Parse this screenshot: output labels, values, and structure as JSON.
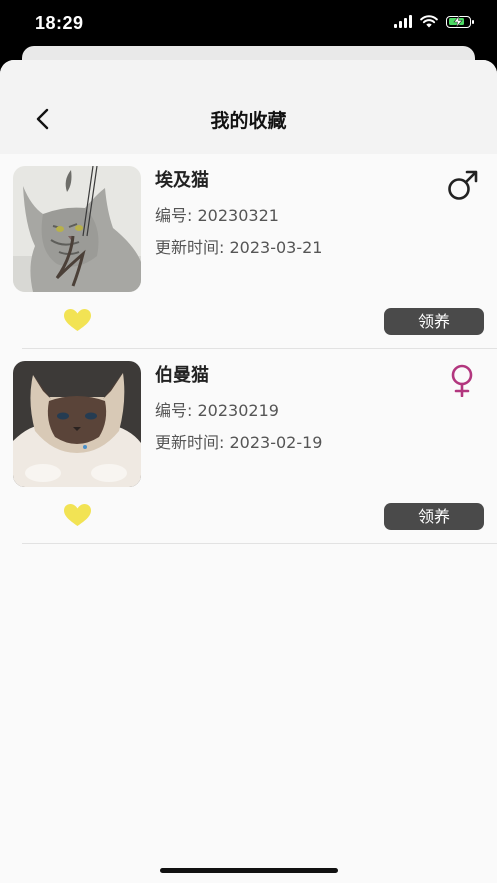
{
  "status_bar": {
    "time": "18:29"
  },
  "header": {
    "title": "我的收藏"
  },
  "favorites": [
    {
      "name": "埃及猫",
      "id_label": "编号: ",
      "id": "20230321",
      "updated_label": "更新时间: ",
      "updated": "2023-03-21",
      "gender": "male",
      "gender_color": "#222222",
      "photo_desc": "grey tabby cat",
      "adopt_label": "领养"
    },
    {
      "name": "伯曼猫",
      "id_label": "编号: ",
      "id": "20230219",
      "updated_label": "更新时间: ",
      "updated": "2023-02-19",
      "gender": "female",
      "gender_color": "#b2367e",
      "photo_desc": "birman cat",
      "adopt_label": "领养"
    }
  ],
  "colors": {
    "heart": "#f2e354",
    "button": "#4a4a4a",
    "battery": "#4cd964"
  }
}
